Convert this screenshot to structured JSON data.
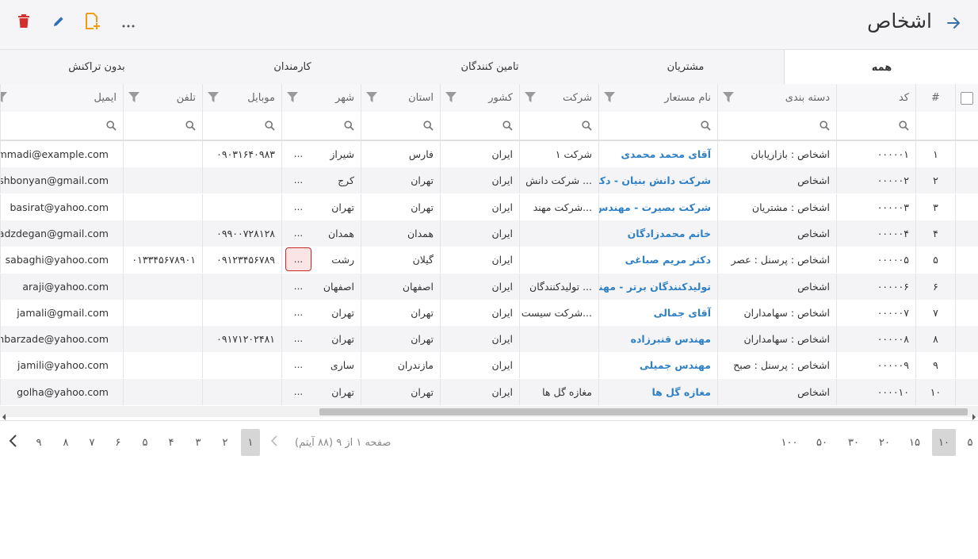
{
  "header": {
    "title": "اشخاص"
  },
  "tabs": [
    {
      "label": "همه",
      "active": true
    },
    {
      "label": "مشتریان",
      "active": false
    },
    {
      "label": "تامین کنندگان",
      "active": false
    },
    {
      "label": "کارمندان",
      "active": false
    },
    {
      "label": "بدون تراکنش",
      "active": false
    }
  ],
  "columns": [
    "#",
    "کد",
    "دسته بندی",
    "نام مستعار",
    "شرکت",
    "کشور",
    "استان",
    "شهر",
    "موبایل",
    "تلفن",
    "ایمیل"
  ],
  "rows": [
    {
      "num": "۱",
      "code": "۰۰۰۰۰۱",
      "category": "اشخاص : بازاریابان",
      "name": "آقای محمد محمدی",
      "company": "شرکت ۱",
      "country": "ایران",
      "province": "فارس",
      "city": "شیراز",
      "mobile": "۰۹۰۳۱۶۴۰۹۸۳",
      "phone": "",
      "email": "mohammadi@example.com"
    },
    {
      "num": "۲",
      "code": "۰۰۰۰۰۲",
      "category": "اشخاص",
      "name": "شرکت دانش بنیان - دکتر م",
      "company": "شرکت دانش ...",
      "country": "ایران",
      "province": "تهران",
      "city": "کرج",
      "mobile": "",
      "phone": "",
      "email": "daneshbonyan@gmail.com"
    },
    {
      "num": "۳",
      "code": "۰۰۰۰۰۳",
      "category": "اشخاص : مشتریان",
      "name": "شرکت بصیرت - مهندس حم",
      "company": "شرکت مهند...",
      "country": "ایران",
      "province": "تهران",
      "city": "تهران",
      "mobile": "",
      "phone": "",
      "email": "basirat@yahoo.com"
    },
    {
      "num": "۴",
      "code": "۰۰۰۰۰۴",
      "category": "اشخاص",
      "name": "خانم محمدزادگان",
      "company": "",
      "country": "ایران",
      "province": "همدان",
      "city": "همدان",
      "mobile": "۰۹۹۰۰۷۲۸۱۲۸",
      "phone": "",
      "email": "mohamadzdegan@gmail.com"
    },
    {
      "num": "۵",
      "code": "۰۰۰۰۰۵",
      "category": "اشخاص : پرسنل : عصر",
      "name": "دکتر مریم صباغی",
      "company": "",
      "country": "ایران",
      "province": "گیلان",
      "city": "رشت",
      "mobile": "۰۹۱۲۳۴۵۶۷۸۹",
      "phone": "۰۱۳۳۴۵۶۷۸۹۰۱",
      "email": "sabaghi@yahoo.com"
    },
    {
      "num": "۶",
      "code": "۰۰۰۰۰۶",
      "category": "اشخاص",
      "name": "تولیدکنندگان برتر - مهندس",
      "company": "تولیدکنندگان ...",
      "country": "ایران",
      "province": "اصفهان",
      "city": "اصفهان",
      "mobile": "",
      "phone": "",
      "email": "araji@yahoo.com"
    },
    {
      "num": "۷",
      "code": "۰۰۰۰۰۷",
      "category": "اشخاص : سهامداران",
      "name": "آقای جمالی",
      "company": "شرکت سیست...",
      "country": "ایران",
      "province": "تهران",
      "city": "تهران",
      "mobile": "",
      "phone": "",
      "email": "jamali@gmail.com"
    },
    {
      "num": "۸",
      "code": "۰۰۰۰۰۸",
      "category": "اشخاص : سهامداران",
      "name": "مهندس قنبرزاده",
      "company": "",
      "country": "ایران",
      "province": "تهران",
      "city": "تهران",
      "mobile": "۰۹۱۷۱۲۰۲۴۸۱",
      "phone": "",
      "email": "ghanbarzade@yahoo.com"
    },
    {
      "num": "۹",
      "code": "۰۰۰۰۰۹",
      "category": "اشخاص : پرسنل : صبح",
      "name": "مهندس جمیلی",
      "company": "",
      "country": "ایران",
      "province": "مازندران",
      "city": "ساری",
      "mobile": "",
      "phone": "",
      "email": "jamili@yahoo.com"
    },
    {
      "num": "۱۰",
      "code": "۰۰۰۰۱۰",
      "category": "اشخاص",
      "name": "مغازه گل ها",
      "company": "مغازه گل ها",
      "country": "ایران",
      "province": "تهران",
      "city": "تهران",
      "mobile": "",
      "phone": "",
      "email": "golha@yahoo.com"
    }
  ],
  "ellipsis": "...",
  "pager": {
    "info": "صفحه ۱ از ۹ (۸۸ آیتم)",
    "pages": [
      "۱",
      "۲",
      "۳",
      "۴",
      "۵",
      "۶",
      "۷",
      "۸",
      "۹"
    ],
    "page_sizes": [
      "۵",
      "۱۰",
      "۱۵",
      "۲۰",
      "۳۰",
      "۵۰",
      "۱۰۰"
    ],
    "selected_page": "۱",
    "selected_size": "۱۰"
  },
  "colors": {
    "accent": "#2f80c4",
    "delete": "#d32f2f",
    "add": "#f39c12",
    "selected_outline": "#c62828"
  },
  "icons": {
    "back": "arrow-right-icon",
    "delete": "trash-icon",
    "edit": "pencil-icon",
    "add": "add-document-icon",
    "more": "more-icon",
    "filter": "funnel-icon",
    "search": "search-icon"
  }
}
